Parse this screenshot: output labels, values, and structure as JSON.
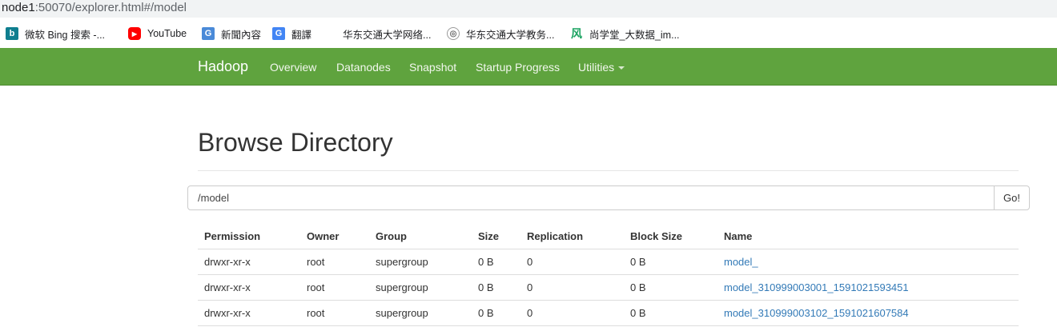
{
  "address_bar": {
    "host": "node1",
    "rest": ":50070/explorer.html#/model"
  },
  "bookmarks": [
    {
      "label": "微软 Bing 搜索 -...",
      "icon": "bing-icon",
      "color": "#0f7e8f",
      "glyph": "b"
    },
    {
      "label": "YouTube",
      "icon": "youtube-icon",
      "color": "#ff0000",
      "glyph": "▶"
    },
    {
      "label": "新聞內容",
      "icon": "news-icon",
      "color": "#4a8ad8",
      "glyph": "G"
    },
    {
      "label": "翻譯",
      "icon": "translate-icon",
      "color": "#4285f4",
      "glyph": "G"
    },
    {
      "label": "华东交通大学网络...",
      "icon": "",
      "color": "",
      "glyph": ""
    },
    {
      "label": "华东交通大学教务...",
      "icon": "globe-icon",
      "color": "#7a7a7a",
      "glyph": "◎"
    },
    {
      "label": "尚学堂_大数据_im...",
      "icon": "feng-icon",
      "color": "#1aa260",
      "glyph": "风"
    }
  ],
  "navbar": {
    "brand": "Hadoop",
    "links": [
      "Overview",
      "Datanodes",
      "Snapshot",
      "Startup Progress",
      "Utilities"
    ],
    "color": "#5fa33e"
  },
  "page": {
    "title": "Browse Directory",
    "path_value": "/model",
    "go_label": "Go!"
  },
  "table": {
    "headers": [
      "Permission",
      "Owner",
      "Group",
      "Size",
      "Replication",
      "Block Size",
      "Name"
    ],
    "rows": [
      [
        "drwxr-xr-x",
        "root",
        "supergroup",
        "0 B",
        "0",
        "0 B",
        "model_"
      ],
      [
        "drwxr-xr-x",
        "root",
        "supergroup",
        "0 B",
        "0",
        "0 B",
        "model_310999003001_1591021593451"
      ],
      [
        "drwxr-xr-x",
        "root",
        "supergroup",
        "0 B",
        "0",
        "0 B",
        "model_310999003102_1591021607584"
      ]
    ]
  }
}
